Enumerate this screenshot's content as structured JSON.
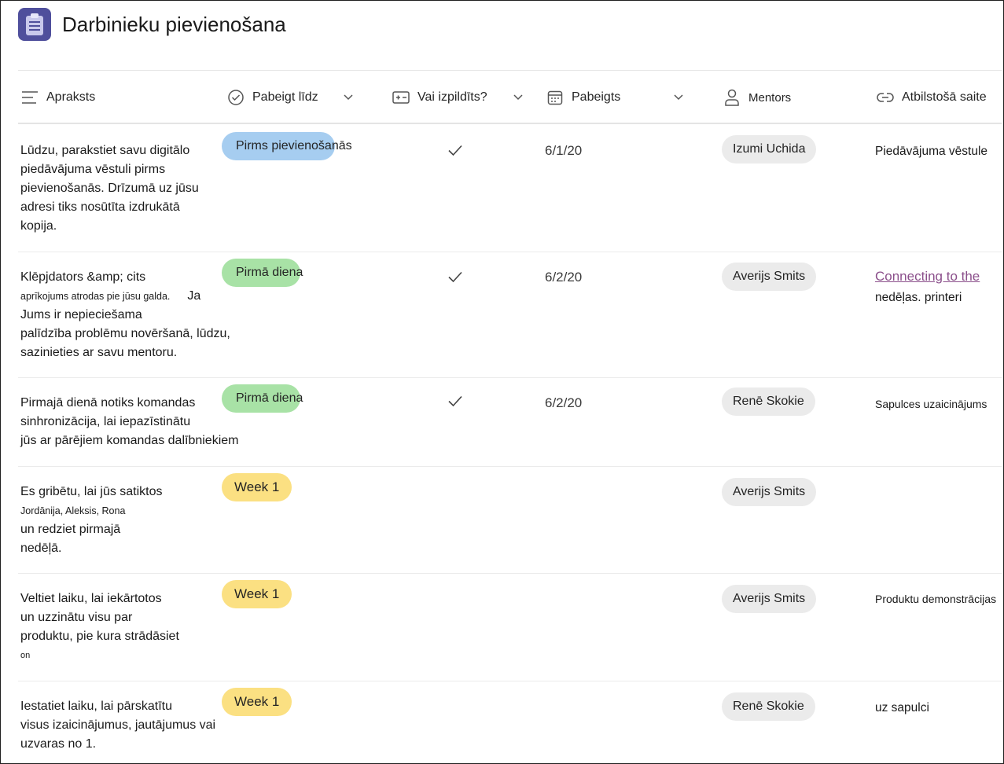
{
  "app": {
    "title": "Darbinieku pievienošana",
    "icon": "clipboard-icon",
    "icon_color": "#4f4f9c"
  },
  "columns": [
    {
      "key": "description",
      "label": "Apraksts",
      "icon": "text-lines-icon"
    },
    {
      "key": "due",
      "label": "Pabeigt līdz",
      "icon": "check-circle-icon"
    },
    {
      "key": "done",
      "label": "Vai izpildīts?",
      "icon": "yes-no-icon"
    },
    {
      "key": "completed",
      "label": "Pabeigts",
      "icon": "calendar-icon"
    },
    {
      "key": "mentor",
      "label": "Mentors",
      "icon": "person-icon"
    },
    {
      "key": "link",
      "label": "Atbilstošā saite",
      "icon": "link-icon"
    }
  ],
  "rows": [
    {
      "desc_lines": [
        "Lūdzu, parakstiet savu digitālo",
        "piedāvājuma vēstuli pirms",
        "pievienošanās. Drīzumā uz jūsu",
        "adresi tiks nosūtīta izdrukātā",
        "kopija."
      ],
      "tag": "Pirms pievienošanās",
      "tag_color": "#a6cdf0",
      "done": true,
      "completed": "6/1/20",
      "mentor": "Izumi Uchida",
      "link_lines": [
        "Piedāvājuma vēstule"
      ]
    },
    {
      "desc_line1": "Klēpjdators &amp; cits",
      "desc_line2a": "aprīkojums atrodas pie jūsu galda.",
      "desc_line2b": "Ja",
      "desc_rest": [
        "Jums ir nepieciešama",
        "palīdzība problēmu novēršanā, lūdzu,",
        "sazinieties ar savu mentoru."
      ],
      "tag": "Pirmā diena",
      "tag_color": "#a8e2a6",
      "done": true,
      "completed": "6/2/20",
      "mentor": "Averijs Smits",
      "link_hyper": "Connecting to the",
      "link_line2": "nedēļas. printeri"
    },
    {
      "desc_lines": [
        "Pirmajā dienā notiks komandas",
        "sinhronizācija, lai iepazīstinātu",
        "jūs ar pārējiem komandas dalībniekiem"
      ],
      "tag": "Pirmā diena",
      "tag_color": "#a8e2a6",
      "done": true,
      "completed": "6/2/20",
      "mentor": "Renē Skokie",
      "link_lines": [
        "Sapulces uzaicinājums"
      ]
    },
    {
      "desc_line1": "Es gribētu, lai jūs satiktos",
      "desc_line2": "Jordānija, Aleksis, Rona",
      "desc_rest": [
        "un redziet pirmajā",
        "nedēļā."
      ],
      "tag": "Week 1",
      "tag_color": "#fbe082",
      "done": false,
      "completed": "",
      "mentor": "Averijs Smits",
      "link_lines": []
    },
    {
      "desc_lines": [
        "Veltiet laiku, lai iekārtotos",
        "un uzzinātu visu par",
        "produktu, pie kura strādāsiet"
      ],
      "desc_tail": "on",
      "tag": "Week 1",
      "tag_color": "#fbe082",
      "done": false,
      "completed": "",
      "mentor": "Averijs Smits",
      "link_lines": [
        "Produktu demonstrācijas"
      ]
    },
    {
      "desc_lines": [
        "Iestatiet laiku, lai pārskatītu",
        "visus izaicinājumus, jautājumus vai",
        "uzvaras no 1."
      ],
      "tag": "Week 1",
      "tag_color": "#fbe082",
      "done": false,
      "completed": "",
      "mentor": "Renē Skokie",
      "link_lines": [
        "uz sapulci"
      ]
    }
  ]
}
